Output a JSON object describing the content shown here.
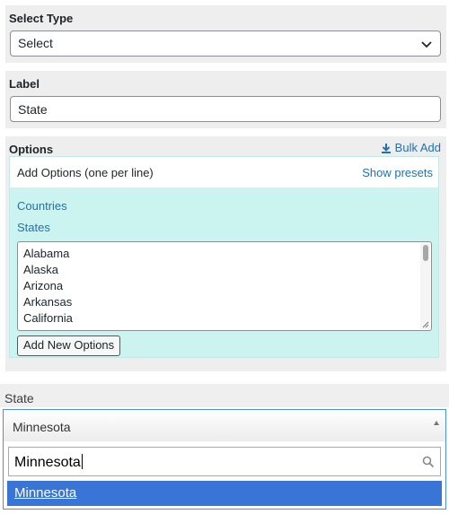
{
  "select_type": {
    "label": "Select Type",
    "value": "Select",
    "icon": "chevron-down-icon"
  },
  "label_field": {
    "label": "Label",
    "value": "State"
  },
  "options": {
    "label": "Options",
    "bulk_add": "Bulk Add",
    "bulk_add_icon": "download-icon",
    "add_options_title": "Add Options (one per line)",
    "show_presets": "Show presets",
    "presets": [
      "Countries",
      "States"
    ],
    "textarea_lines": [
      "Alabama",
      "Alaska",
      "Arizona",
      "Arkansas",
      "California"
    ],
    "add_button": "Add New Options"
  },
  "preview": {
    "label": "State",
    "selected": "Minnesota",
    "search_value": "Minnesota",
    "result": "Minnesota",
    "accent": "#3875d7"
  }
}
